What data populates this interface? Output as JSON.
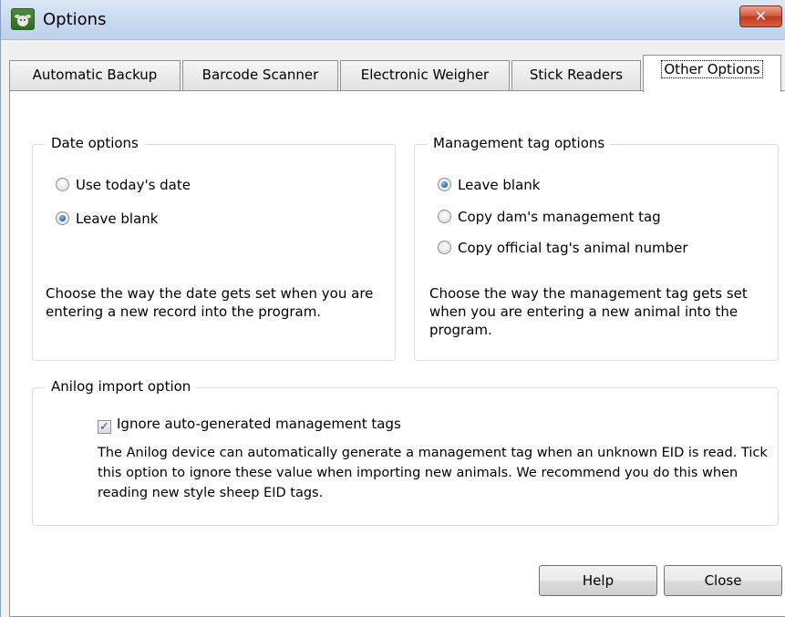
{
  "window": {
    "title": "Options",
    "close_glyph": "✕"
  },
  "tabs": [
    {
      "label": "Automatic Backup"
    },
    {
      "label": "Barcode Scanner"
    },
    {
      "label": "Electronic Weigher"
    },
    {
      "label": "Stick Readers"
    },
    {
      "label": "Other Options",
      "active": true
    }
  ],
  "date_options": {
    "legend": "Date options",
    "options": [
      {
        "label": "Use today's date",
        "checked": false
      },
      {
        "label": "Leave blank",
        "checked": true
      }
    ],
    "description": "Choose the way the date gets set when you are entering a new record into the program."
  },
  "management_tag_options": {
    "legend": "Management tag options",
    "options": [
      {
        "label": "Leave blank",
        "checked": true
      },
      {
        "label": "Copy dam's management tag",
        "checked": false
      },
      {
        "label": "Copy official tag's animal number",
        "checked": false
      }
    ],
    "description": "Choose the way the management tag gets set when you are entering a new animal into the program."
  },
  "anilog_import": {
    "legend": "Anilog import option",
    "checkbox_label": "Ignore auto-generated management tags",
    "checkbox_checked": true,
    "description": "The Anilog device can automatically generate a management tag when an unknown EID is read. Tick this option to ignore these value when importing new animals. We recommend you do this when reading new style sheep EID tags."
  },
  "buttons": {
    "help": "Help",
    "close": "Close"
  },
  "icons": {
    "app": "sheep-icon",
    "close": "close-icon",
    "radio": "radio-icon",
    "checkbox": "checkbox-icon"
  },
  "colors": {
    "titlebar": "#c8daf0",
    "close_button": "#c0391f",
    "radio_dot": "#2a6fbf"
  }
}
